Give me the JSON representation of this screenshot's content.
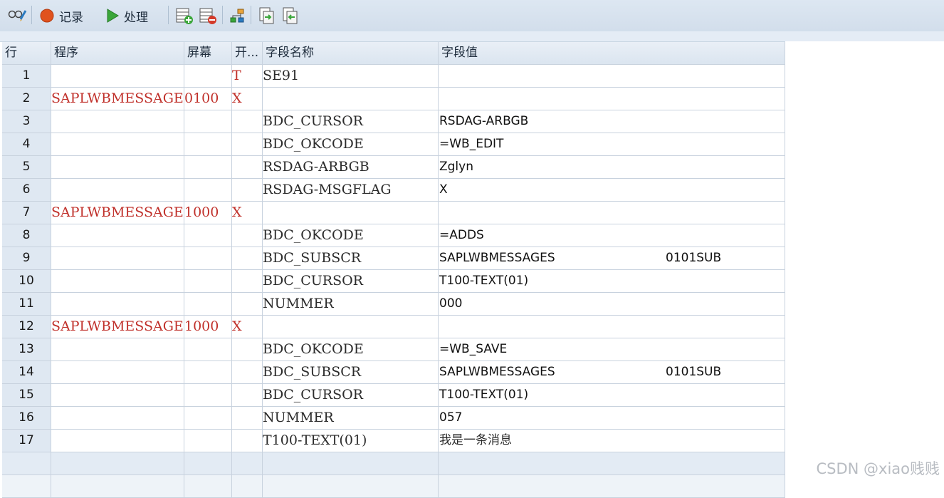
{
  "toolbar": {
    "record_label": "记录",
    "process_label": "处理"
  },
  "columns": [
    "行",
    "程序",
    "屏幕",
    "开...",
    "字段名称",
    "字段值"
  ],
  "rows": [
    {
      "n": "1",
      "prog": "",
      "screen": "",
      "start": "T",
      "field": "SE91",
      "value": "",
      "value2": ""
    },
    {
      "n": "2",
      "prog": "SAPLWBMESSAGES",
      "screen": "0100",
      "start": "X",
      "field": "",
      "value": "",
      "value2": ""
    },
    {
      "n": "3",
      "prog": "",
      "screen": "",
      "start": "",
      "field": "BDC_CURSOR",
      "value": "RSDAG-ARBGB",
      "value2": ""
    },
    {
      "n": "4",
      "prog": "",
      "screen": "",
      "start": "",
      "field": "BDC_OKCODE",
      "value": "=WB_EDIT",
      "value2": ""
    },
    {
      "n": "5",
      "prog": "",
      "screen": "",
      "start": "",
      "field": "RSDAG-ARBGB",
      "value": "Zglyn",
      "value2": ""
    },
    {
      "n": "6",
      "prog": "",
      "screen": "",
      "start": "",
      "field": "RSDAG-MSGFLAG",
      "value": "X",
      "value2": ""
    },
    {
      "n": "7",
      "prog": "SAPLWBMESSAGES",
      "screen": "1000",
      "start": "X",
      "field": "",
      "value": "",
      "value2": ""
    },
    {
      "n": "8",
      "prog": "",
      "screen": "",
      "start": "",
      "field": "BDC_OKCODE",
      "value": "=ADDS",
      "value2": ""
    },
    {
      "n": "9",
      "prog": "",
      "screen": "",
      "start": "",
      "field": "BDC_SUBSCR",
      "value": "SAPLWBMESSAGES",
      "value2": "0101SUB"
    },
    {
      "n": "10",
      "prog": "",
      "screen": "",
      "start": "",
      "field": "BDC_CURSOR",
      "value": "T100-TEXT(01)",
      "value2": ""
    },
    {
      "n": "11",
      "prog": "",
      "screen": "",
      "start": "",
      "field": "NUMMER",
      "value": "000",
      "value2": ""
    },
    {
      "n": "12",
      "prog": "SAPLWBMESSAGES",
      "screen": "1000",
      "start": "X",
      "field": "",
      "value": "",
      "value2": ""
    },
    {
      "n": "13",
      "prog": "",
      "screen": "",
      "start": "",
      "field": "BDC_OKCODE",
      "value": "=WB_SAVE",
      "value2": ""
    },
    {
      "n": "14",
      "prog": "",
      "screen": "",
      "start": "",
      "field": "BDC_SUBSCR",
      "value": "SAPLWBMESSAGES",
      "value2": "0101SUB"
    },
    {
      "n": "15",
      "prog": "",
      "screen": "",
      "start": "",
      "field": "BDC_CURSOR",
      "value": "T100-TEXT(01)",
      "value2": ""
    },
    {
      "n": "16",
      "prog": "",
      "screen": "",
      "start": "",
      "field": "NUMMER",
      "value": "057",
      "value2": ""
    },
    {
      "n": "17",
      "prog": "",
      "screen": "",
      "start": "",
      "field": "T100-TEXT(01)",
      "value": "我是一条消息",
      "value2": ""
    }
  ],
  "watermark": "CSDN @xiao贱贱",
  "colors": {
    "accent_red": "#c0302a",
    "toolbar_bg": "#d2deeb",
    "header_bg": "#dbe5f0"
  },
  "icons": [
    "glasses-icon",
    "record-icon",
    "play-icon",
    "insert-row-icon",
    "delete-row-icon",
    "hierarchy-icon",
    "export-icon",
    "import-icon"
  ]
}
